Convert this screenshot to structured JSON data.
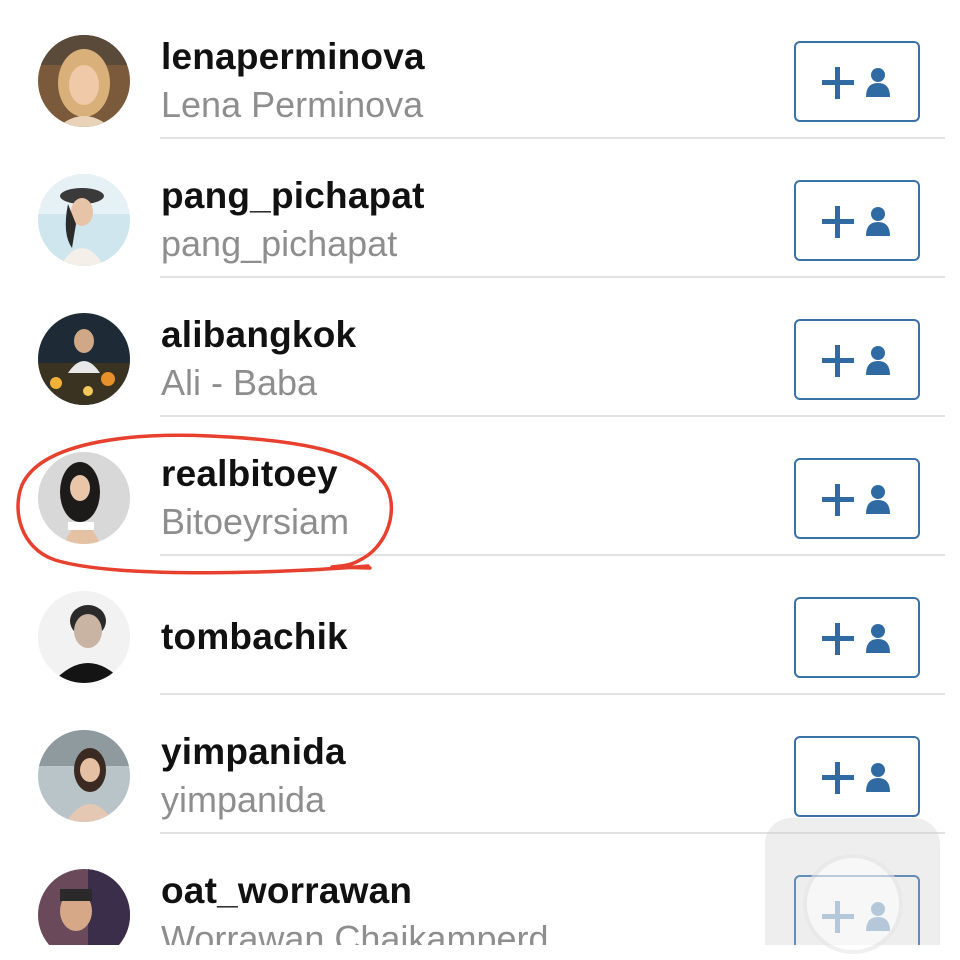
{
  "accent_color": "#3a72a8",
  "list": {
    "rows": [
      {
        "username": "lenaperminova",
        "full_name": "Lena Perminova",
        "avatar": "avatar-photo",
        "follow_icon": "add-user-icon"
      },
      {
        "username": "pang_pichapat",
        "full_name": "pang_pichapat",
        "avatar": "avatar-photo",
        "follow_icon": "add-user-icon"
      },
      {
        "username": "alibangkok",
        "full_name": "Ali - Baba",
        "avatar": "avatar-photo",
        "follow_icon": "add-user-icon"
      },
      {
        "username": "realbitoey",
        "full_name": "Bitoeyrsiam",
        "avatar": "avatar-photo",
        "follow_icon": "add-user-icon"
      },
      {
        "username": "tombachik",
        "full_name": "",
        "avatar": "avatar-photo",
        "follow_icon": "add-user-icon"
      },
      {
        "username": "yimpanida",
        "full_name": "yimpanida",
        "avatar": "avatar-photo",
        "follow_icon": "add-user-icon"
      },
      {
        "username": "oat_worrawan",
        "full_name": "Worrawan Chaikamperd",
        "avatar": "avatar-photo",
        "follow_icon": "add-user-icon"
      }
    ]
  },
  "annotation": {
    "color": "#e8402e",
    "shape": "hand-drawn-circle"
  }
}
